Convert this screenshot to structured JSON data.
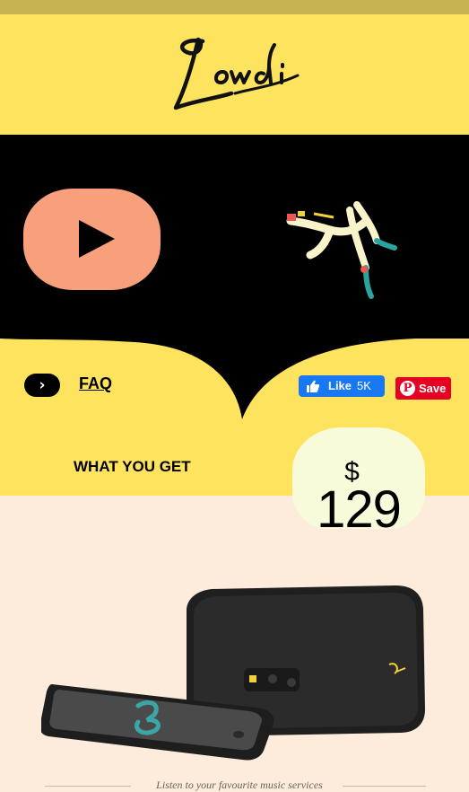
{
  "brand": {
    "logo_text": "Lowdi",
    "accent": "#fde35e",
    "dark": "#000000",
    "peach": "#fdebdc"
  },
  "hero": {
    "play_color": "#f7a07b"
  },
  "links": {
    "faq_label": "FAQ"
  },
  "social": {
    "like_label": "Like",
    "like_count": "5K",
    "pin_label": "Save"
  },
  "section": {
    "what_you_get": "WHAT YOU GET"
  },
  "price": {
    "currency": "$",
    "amount": "129"
  },
  "caption": "Listen to your favourite music services",
  "icons": [
    "chevron-right-icon",
    "play-icon",
    "thumbs-up-icon",
    "pinterest-icon"
  ]
}
